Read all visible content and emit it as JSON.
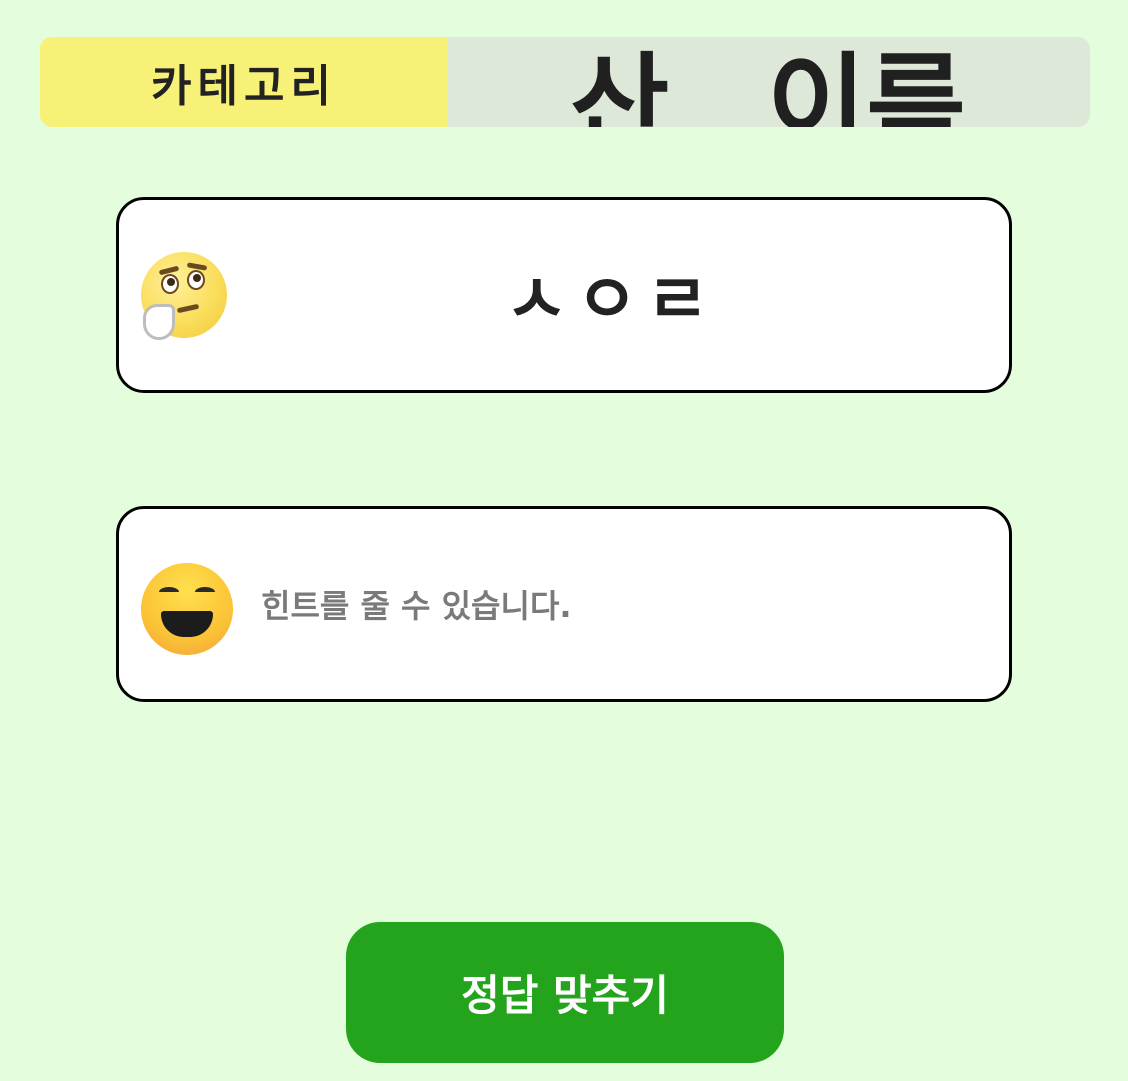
{
  "header": {
    "category_label": "카테고리",
    "title": "산 이름"
  },
  "quiz": {
    "consonants": "ㅅㅇㄹ",
    "icon": "thinking-face-icon"
  },
  "hint": {
    "text": "힌트를 줄 수 있습니다.",
    "icon": "smiling-face-icon"
  },
  "actions": {
    "submit_label": "정답 맞추기"
  },
  "colors": {
    "background": "#e4fedd",
    "category_bg": "#f7f277",
    "header_bg": "#dde8d8",
    "button_bg": "#24a41c"
  }
}
